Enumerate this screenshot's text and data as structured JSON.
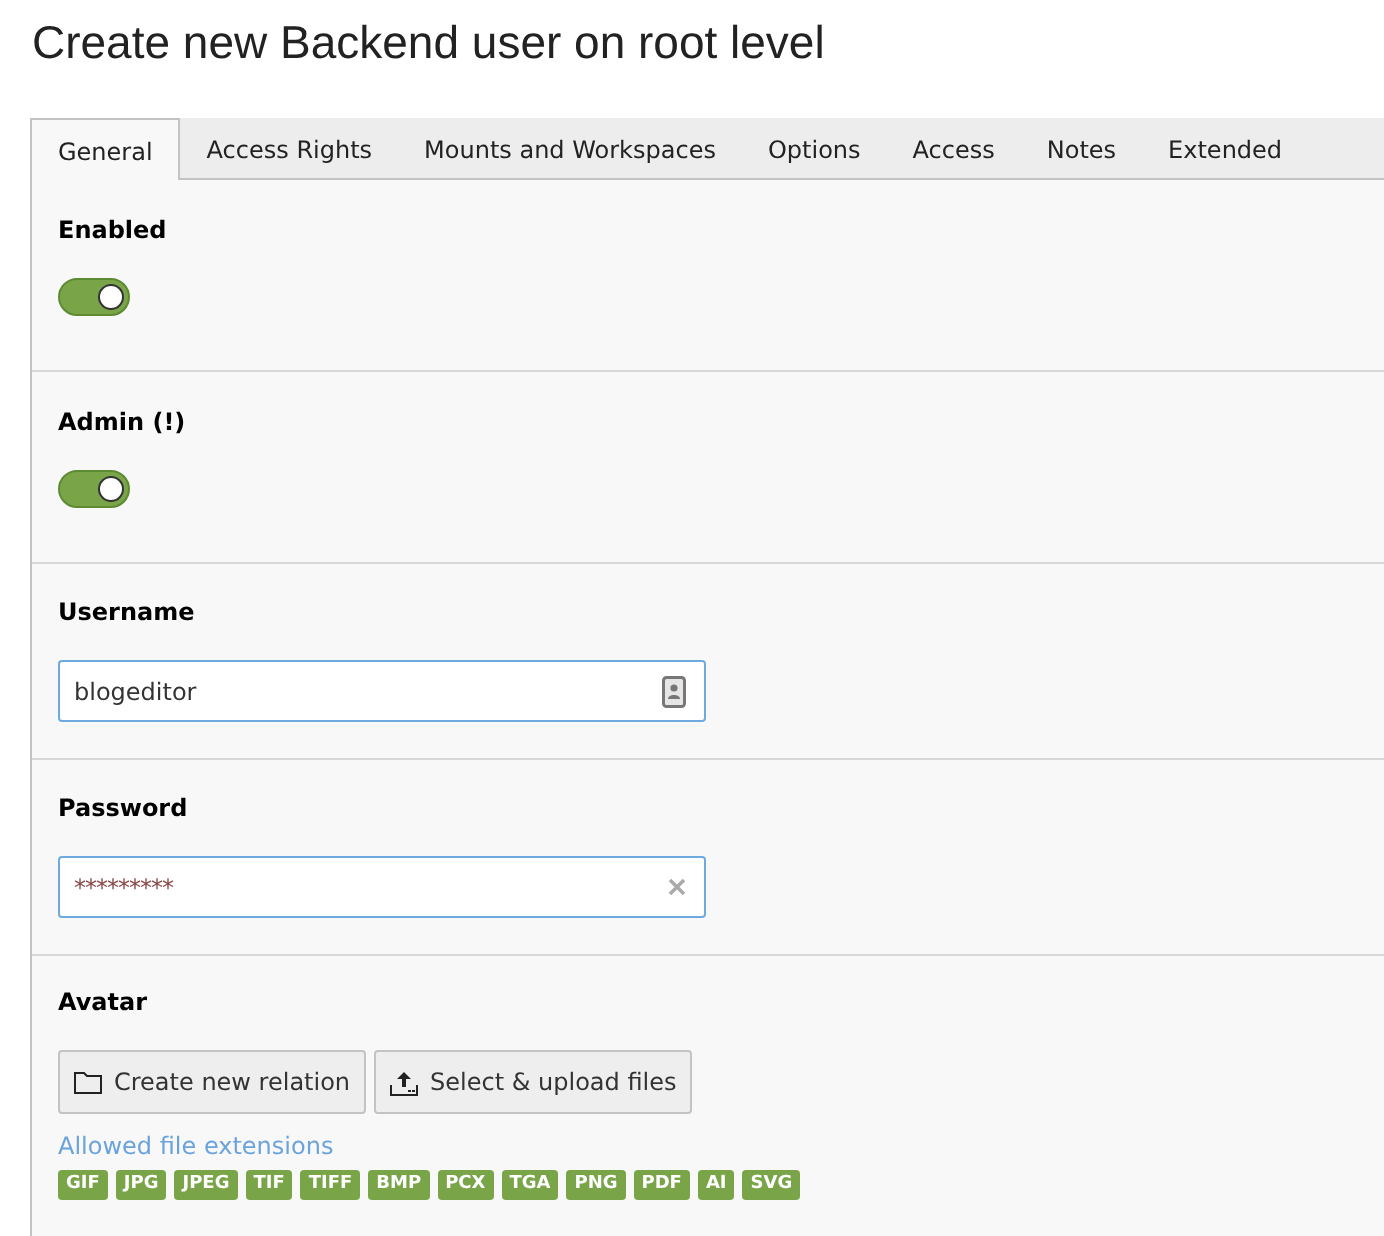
{
  "page_title": "Create new Backend user on root level",
  "tabs": [
    {
      "label": "General",
      "selected": true
    },
    {
      "label": "Access Rights",
      "selected": false
    },
    {
      "label": "Mounts and Workspaces",
      "selected": false
    },
    {
      "label": "Options",
      "selected": false
    },
    {
      "label": "Access",
      "selected": false
    },
    {
      "label": "Notes",
      "selected": false
    },
    {
      "label": "Extended",
      "selected": false
    }
  ],
  "fields": [
    {
      "kind": "toggle",
      "label": "Enabled",
      "on": true
    },
    {
      "kind": "toggle",
      "label": "Admin (!)",
      "on": true
    },
    {
      "kind": "text",
      "label": "Username",
      "value": "blogeditor"
    },
    {
      "kind": "password",
      "label": "Password",
      "value": "*********"
    },
    {
      "kind": "files",
      "label": "Avatar",
      "buttons": [
        {
          "kind": "create",
          "label": "Create new relation"
        },
        {
          "kind": "upload",
          "label": "Select & upload files"
        }
      ],
      "allowed_label": "Allowed file extensions",
      "extensions": [
        "GIF",
        "JPG",
        "JPEG",
        "TIF",
        "TIFF",
        "BMP",
        "PCX",
        "TGA",
        "PNG",
        "PDF",
        "AI",
        "SVG"
      ]
    }
  ]
}
